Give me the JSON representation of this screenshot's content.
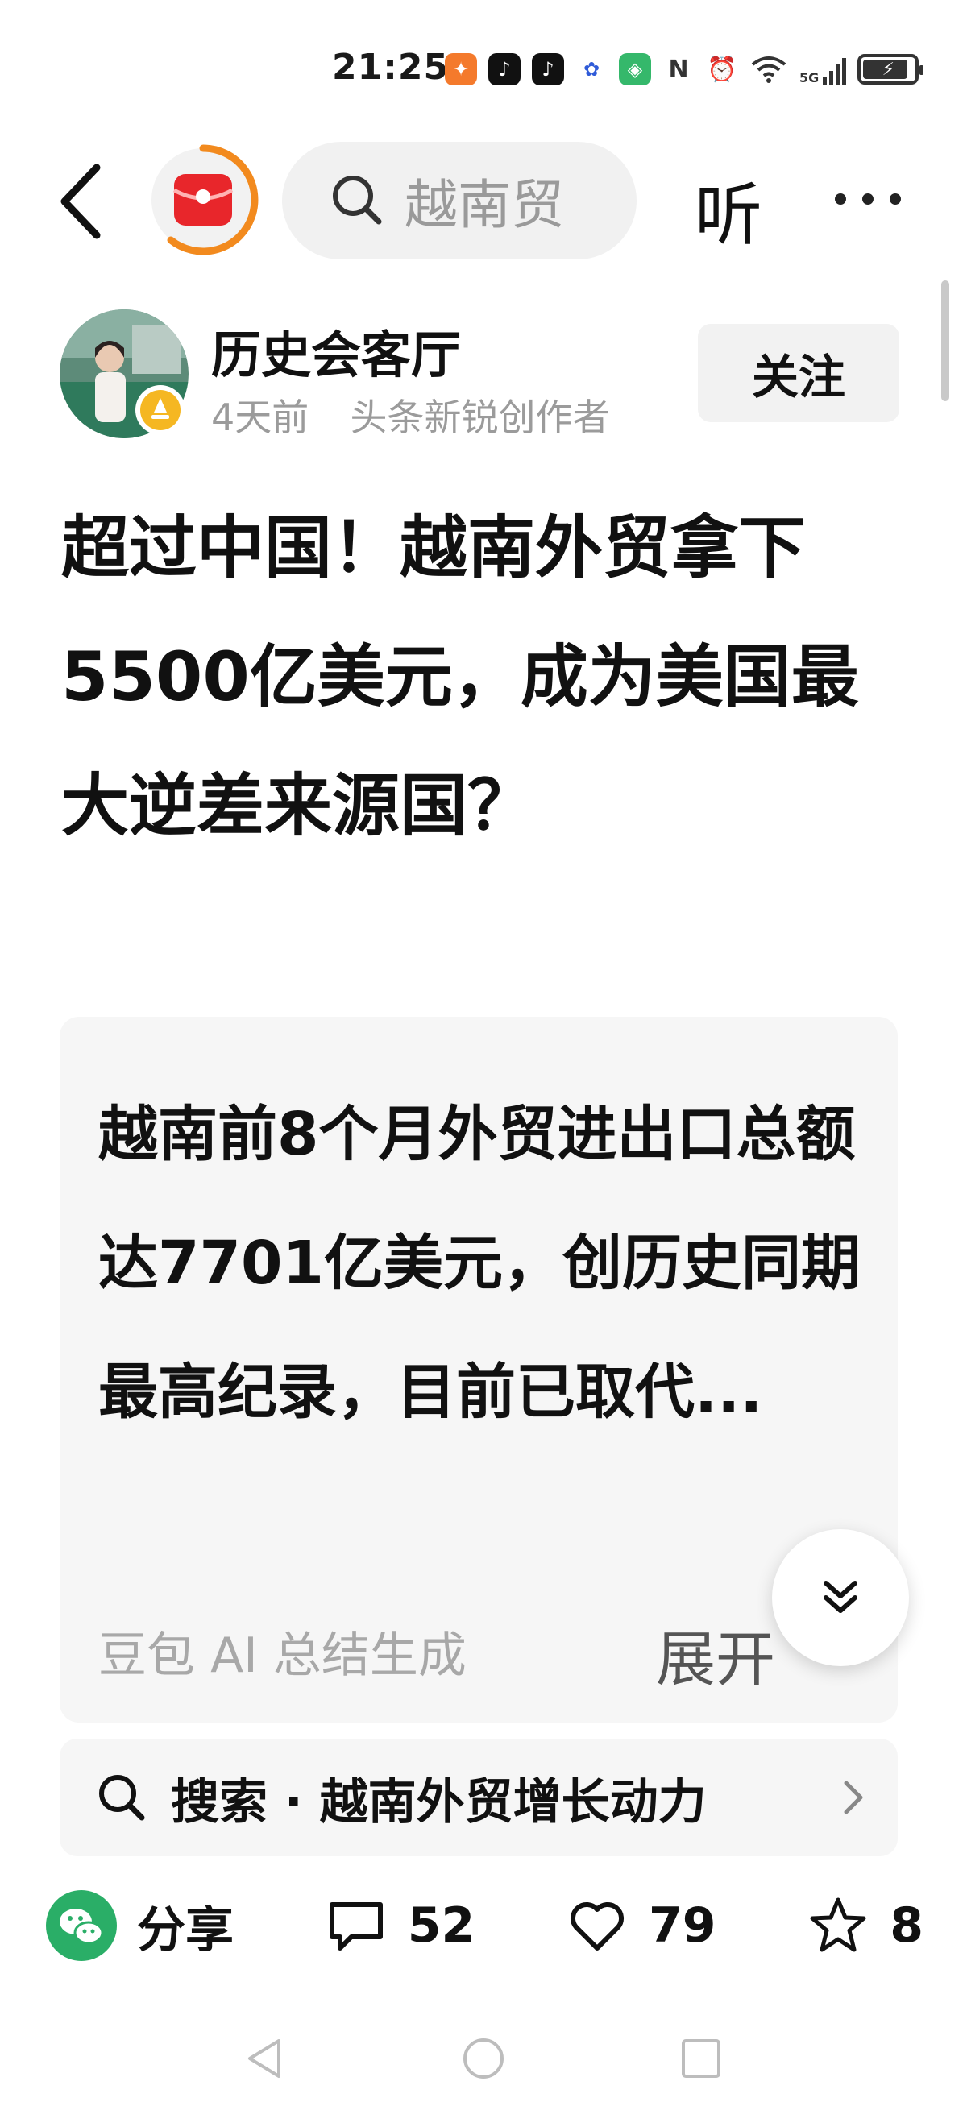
{
  "status_bar": {
    "time": "21:25",
    "network": "5G"
  },
  "top_nav": {
    "search_text": "越南贸",
    "listen_label": "听"
  },
  "author": {
    "name": "历史会客厅",
    "time_ago": "4天前",
    "badge": "头条新锐创作者",
    "follow_label": "关注"
  },
  "article": {
    "title": "超过中国！越南外贸拿下5500亿美元，成为美国最大逆差来源国？"
  },
  "summary": {
    "text": "越南前8个月外贸进出口总额达7701亿美元，创历史同期最高纪录，目前已取代...",
    "source": "豆包 AI 总结生成",
    "expand_label": "展开"
  },
  "related_search": {
    "text": "搜索 · 越南外贸增长动力"
  },
  "actions": {
    "share_label": "分享",
    "comments": "52",
    "likes": "79",
    "favorites": "8"
  },
  "colors": {
    "accent_orange": "#f28a1e",
    "logo_red": "#e8262b",
    "wechat_green": "#2aae67"
  }
}
